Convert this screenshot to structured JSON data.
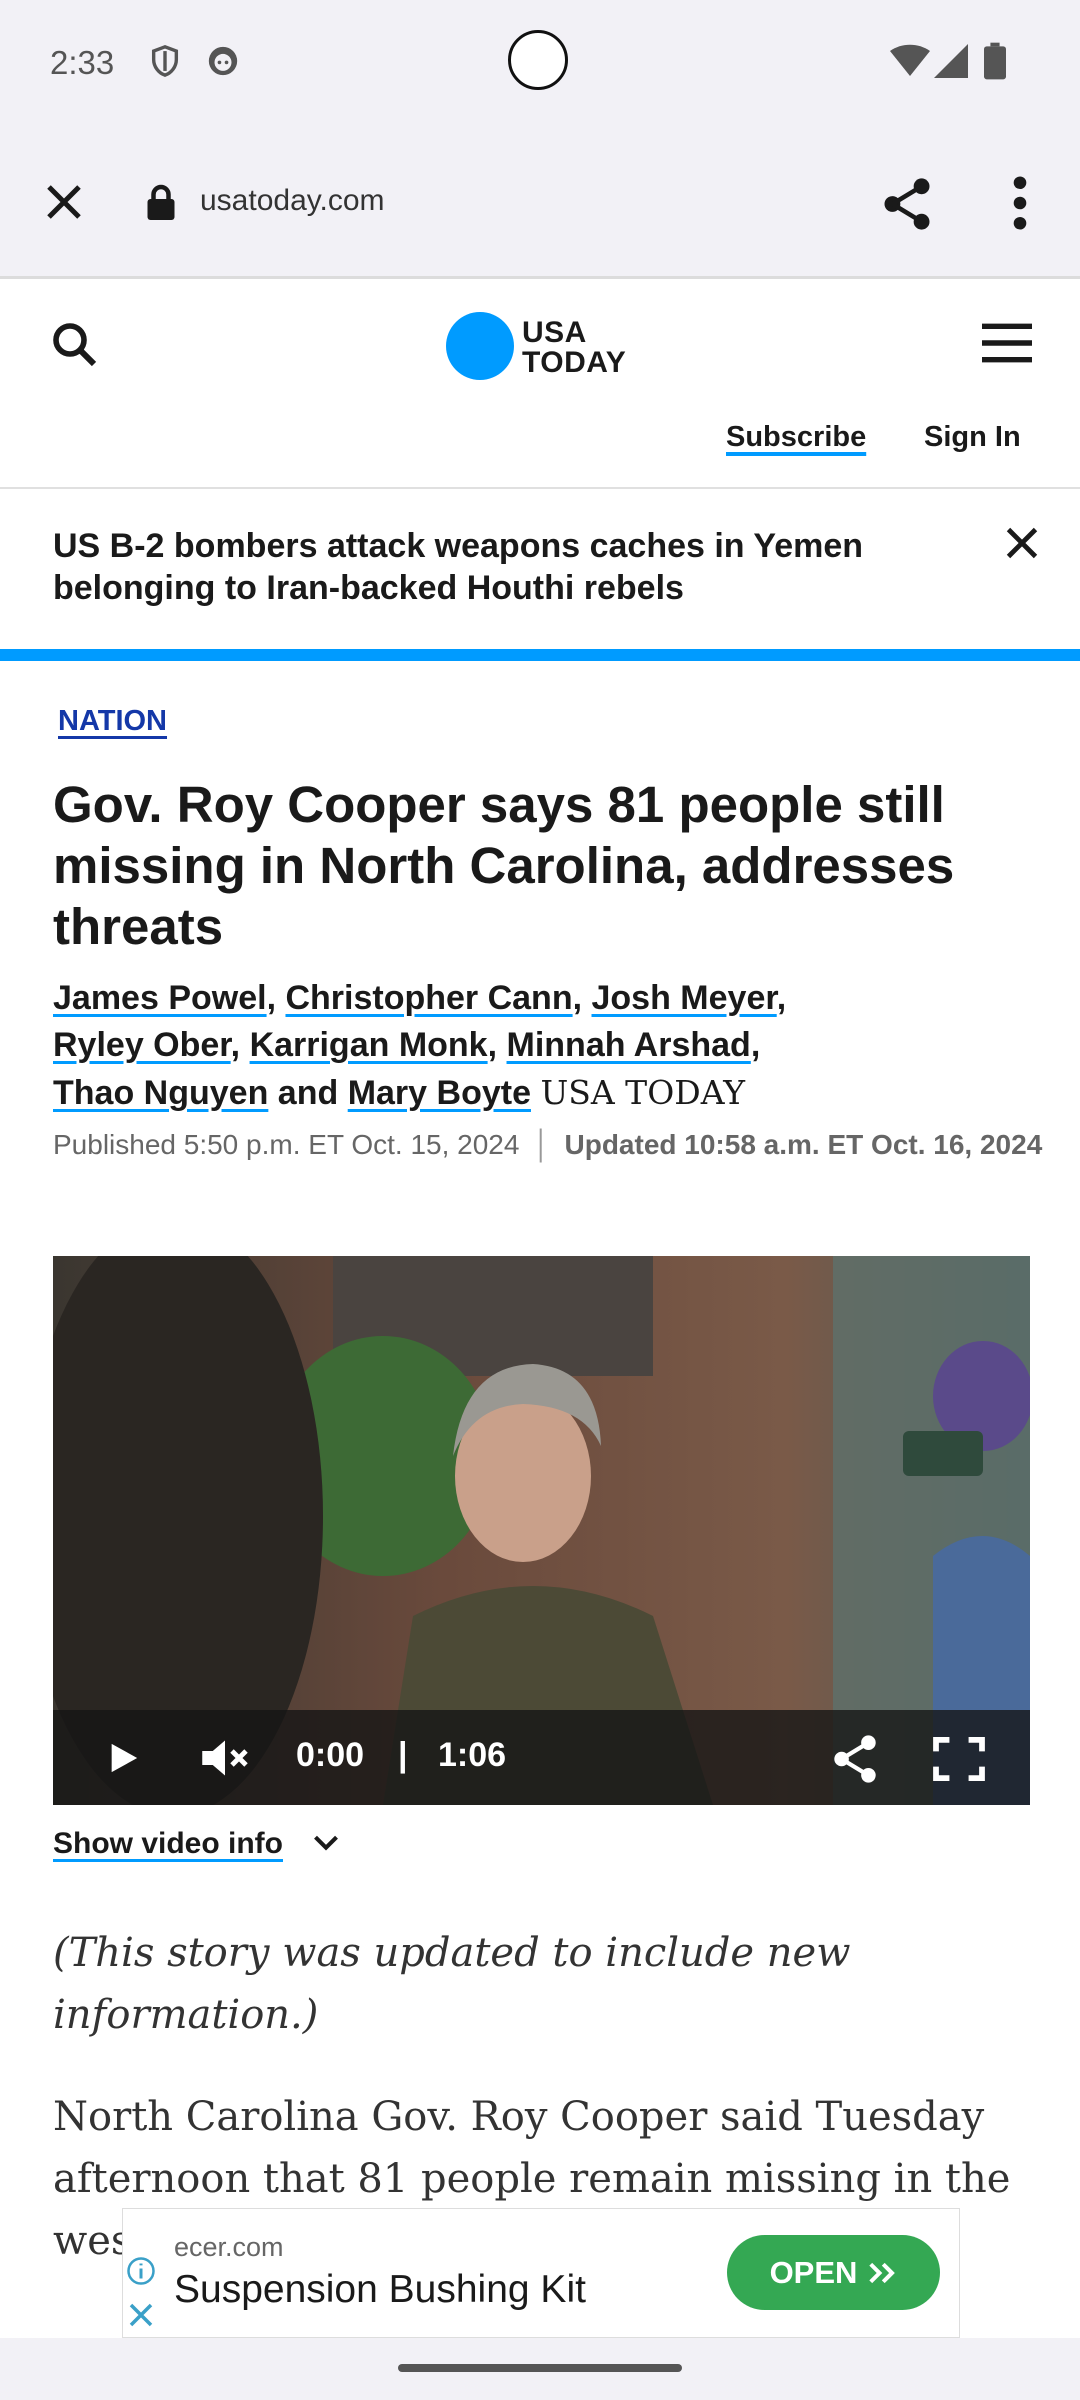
{
  "status_bar": {
    "time": "2:33"
  },
  "browser": {
    "url": "usatoday.com"
  },
  "site": {
    "logo_line1": "USA",
    "logo_line2": "TODAY",
    "subscribe": "Subscribe",
    "sign_in": "Sign In"
  },
  "breaking": {
    "text": "US B-2 bombers attack weapons caches in Yemen belonging to Iran-backed Houthi rebels"
  },
  "article": {
    "section": "NATION",
    "headline": "Gov. Roy Cooper says 81 people still missing in North Carolina, addresses threats",
    "authors": [
      "James Powel",
      "Christopher Cann",
      "Josh Meyer",
      "Ryley Ober",
      "Karrigan Monk",
      "Minnah Arshad",
      "Thao Nguyen",
      "Mary Boyte"
    ],
    "and": "and",
    "organization": "USA TODAY",
    "published": "Published 5:50 p.m. ET Oct. 15, 2024",
    "updated": "Updated 10:58 a.m. ET Oct. 16, 2024",
    "note": "(This story was updated to include new information.)",
    "body": "North Carolina Gov. Roy Cooper said Tuesday afternoon that 81 people remain missing in the western part of the state after Hurricane"
  },
  "video": {
    "current_time": "0:00",
    "separator": "|",
    "duration": "1:06",
    "show_info": "Show video info"
  },
  "ad": {
    "domain": "ecer.com",
    "title": "Suspension Bushing Kit",
    "cta": "OPEN"
  },
  "colors": {
    "accent": "#009bff",
    "section": "#1438a8",
    "ad_button": "#34a853"
  }
}
